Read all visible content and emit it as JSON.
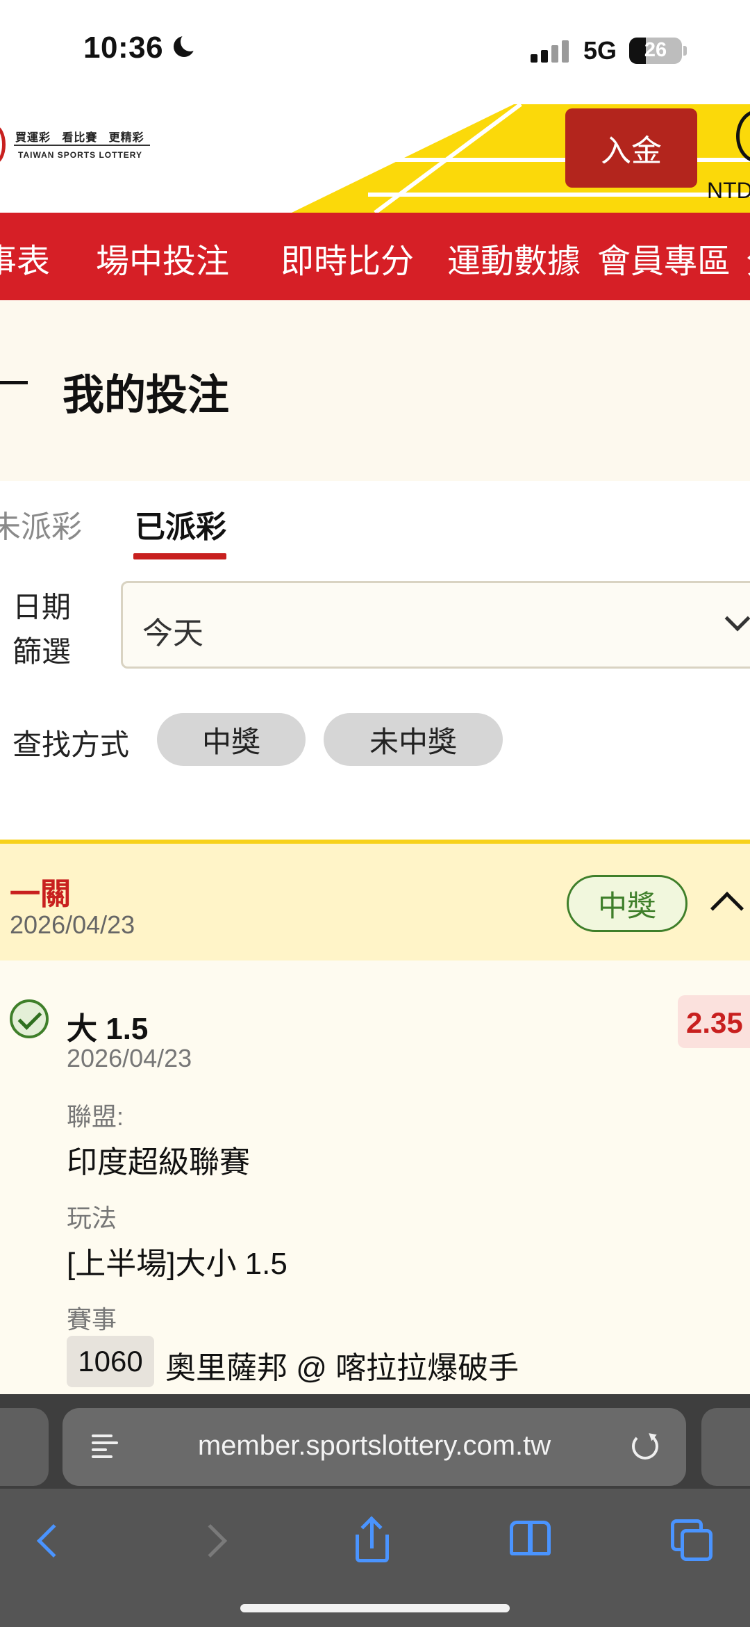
{
  "status_bar": {
    "time": "10:36",
    "network": "5G",
    "battery": "26"
  },
  "header": {
    "logo_cn": "買運彩   看比賽   更精彩",
    "logo_en": "TAIWAN SPORTS LOTTERY",
    "deposit_label": "入金",
    "currency": "NTD"
  },
  "nav": {
    "items": [
      {
        "label": "事表"
      },
      {
        "label": "場中投注"
      },
      {
        "label": "即時比分"
      },
      {
        "label": "運動數據"
      },
      {
        "label": "會員專區"
      },
      {
        "label": "分"
      }
    ]
  },
  "page": {
    "title": "我的投注"
  },
  "tabs": {
    "unpaid": "未派彩",
    "paid": "已派彩",
    "active": "paid"
  },
  "filters": {
    "date_label": "日期篩選",
    "date_value": "今天",
    "search_label": "查找方式",
    "chips": [
      {
        "label": "中獎"
      },
      {
        "label": "未中獎"
      }
    ]
  },
  "bet": {
    "type": "一關",
    "date": "2026/04/23",
    "status": "中獎",
    "selection": "大 1.5",
    "selection_date": "2026/04/23",
    "odds": "2.35",
    "league_label": "聯盟:",
    "league": "印度超級聯賽",
    "market_label": "玩法",
    "market": "[上半場]大小 1.5",
    "event_label": "賽事",
    "match_no": "1060",
    "match": "奧里薩邦 @ 喀拉拉爆破手"
  },
  "browser": {
    "url": "member.sportslottery.com.tw"
  },
  "colors": {
    "brand_red": "#d61f26",
    "accent_yellow": "#f7d11b",
    "win_green": "#3f7f2a",
    "odds_red": "#c8201f"
  }
}
